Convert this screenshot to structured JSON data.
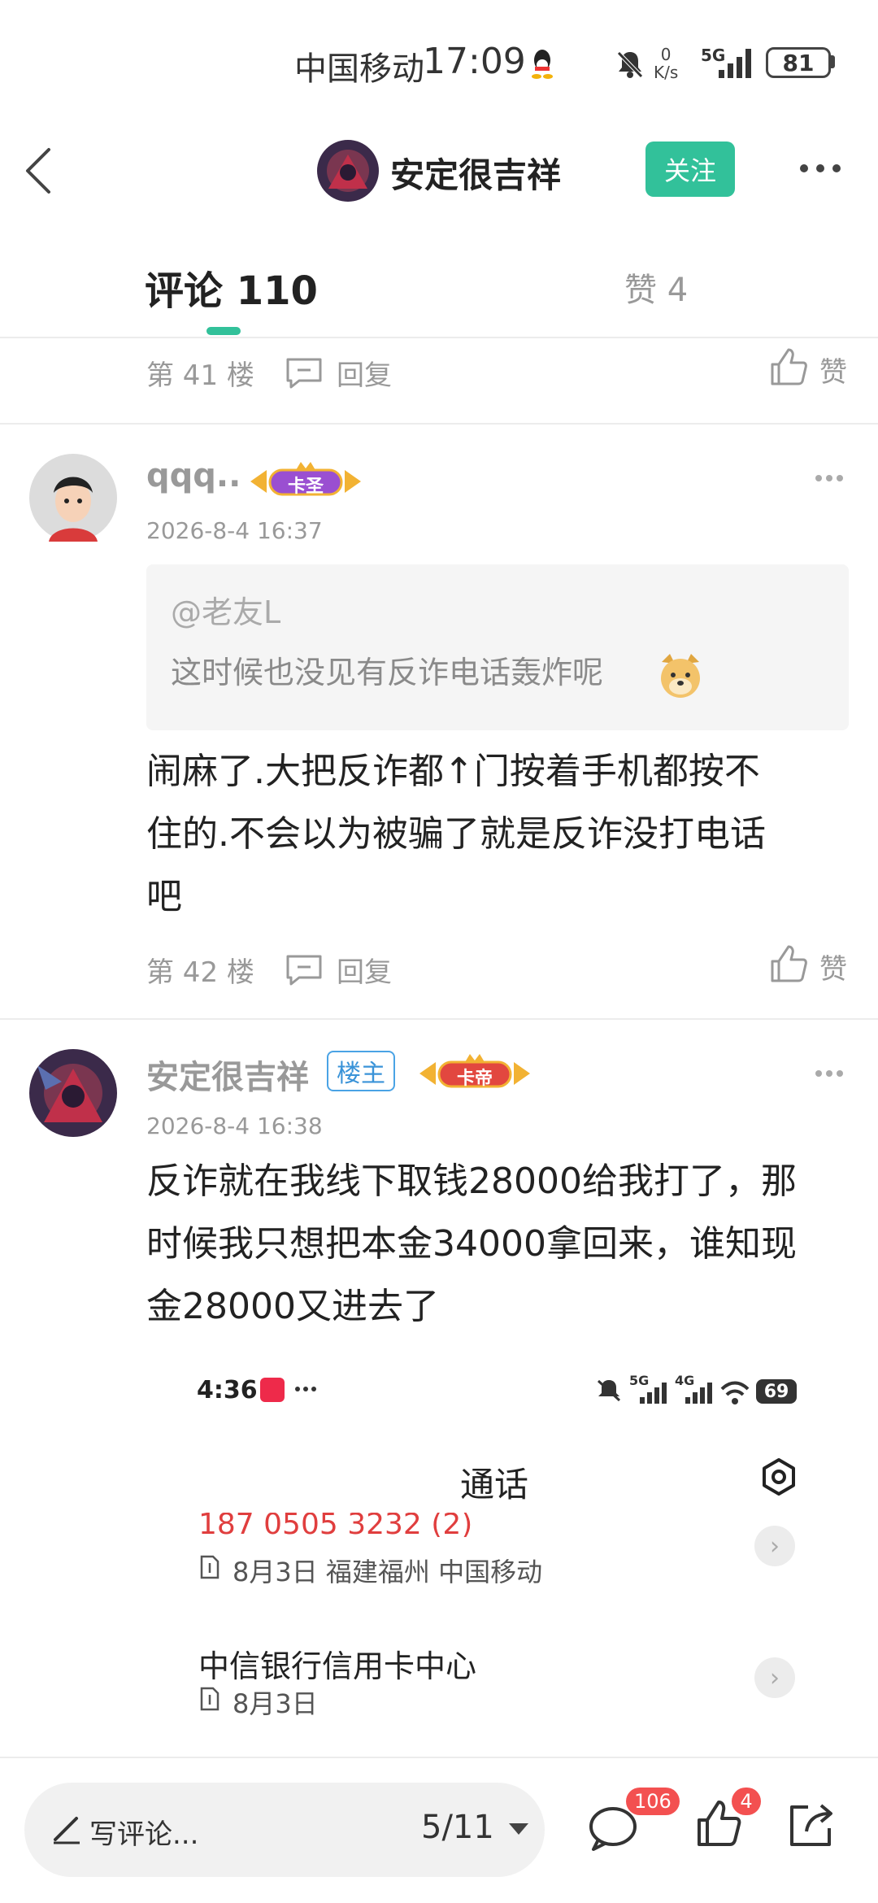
{
  "status_bar": {
    "carrier": "中国移动",
    "time": "17:09",
    "speed_value": "0",
    "speed_unit": "K/s",
    "network": "5G",
    "battery": "81"
  },
  "header": {
    "author_name": "安定很吉祥",
    "follow_label": "关注"
  },
  "tabs": {
    "comments_label": "评论 110",
    "likes_label": "赞 4"
  },
  "floor41": {
    "floor_label": "第 41 楼",
    "reply_label": "回复",
    "like_label": "赞"
  },
  "comment42": {
    "username": "qqq..",
    "level_badge": "卡圣",
    "timestamp": "2026-8-4 16:37",
    "quote_user": "@老友L",
    "quote_text": "这时候也没见有反诈电话轰炸呢",
    "body_lines": [
      "闹麻了.大把反诈都↑门按着手机都按不",
      "住的.不会以为被骗了就是反诈没打电话",
      "吧"
    ],
    "floor_label": "第 42 楼",
    "reply_label": "回复",
    "like_label": "赞"
  },
  "comment43": {
    "username": "安定很吉祥",
    "op_badge": "楼主",
    "level_badge": "卡帝",
    "timestamp": "2026-8-4 16:38",
    "body_lines": [
      "反诈就在我线下取钱28000给我打了，那",
      "时候我只想把本金34000拿回来，谁知现",
      "金28000又进去了"
    ]
  },
  "embedded_screenshot": {
    "time": "4:36",
    "network_a": "5G",
    "network_b": "4G",
    "battery": "69",
    "title": "通话",
    "red_number": "187 0505 3232 (2)",
    "row1_detail": "8月3日 福建福州 中国移动",
    "row2_name": "中信银行信用卡中心",
    "row2_detail": "8月3日"
  },
  "bottom_bar": {
    "write_label": "写评论...",
    "page_indicator": "5/11",
    "comment_count": "106",
    "like_count": "4"
  },
  "colors": {
    "accent": "#32c19a",
    "badge_red": "#f35050",
    "op_blue": "#3a93d8"
  }
}
